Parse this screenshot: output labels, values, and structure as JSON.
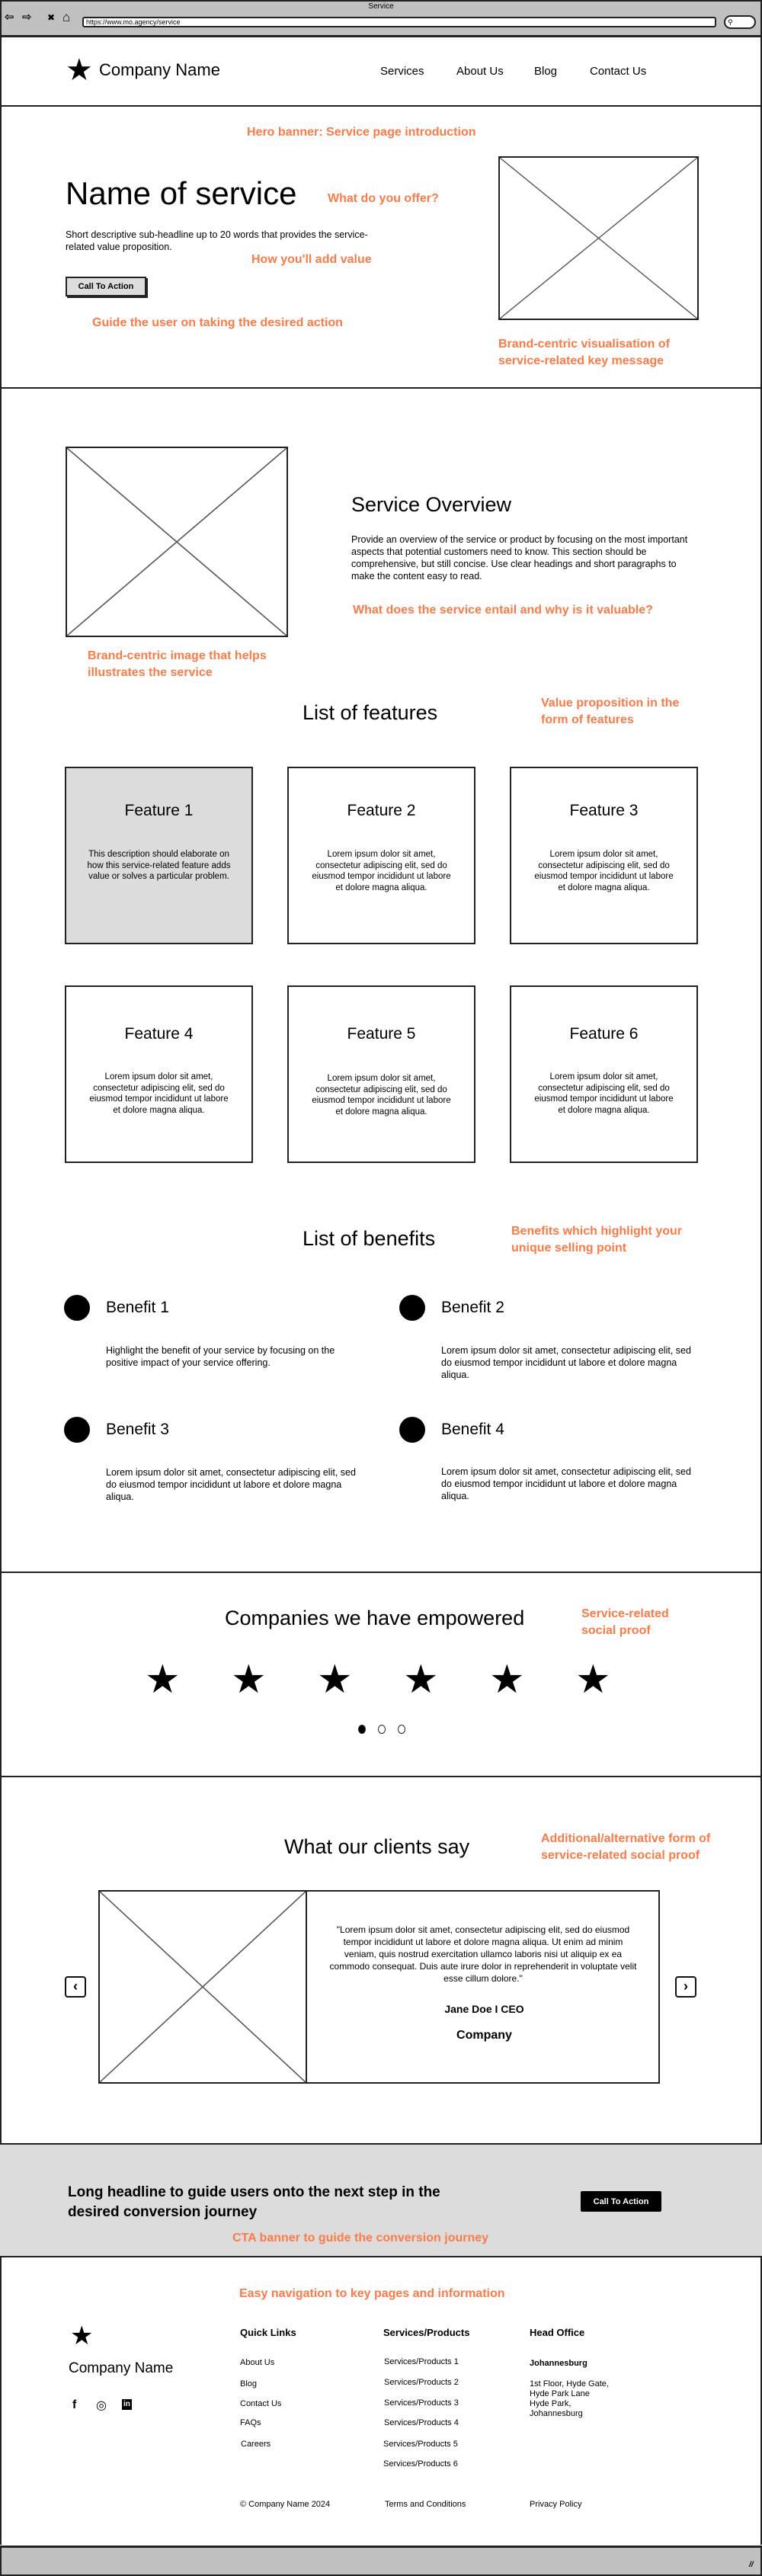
{
  "browser": {
    "title": "Service",
    "url": "https://www.mo.agency/service",
    "icons": [
      "back-arrow-icon",
      "forward-arrow-icon",
      "close-icon",
      "home-icon",
      "search-icon"
    ],
    "back_glyph": "⇦",
    "forward_glyph": "⇨",
    "close_glyph": "✖",
    "home_glyph": "⌂",
    "search_glyph": "⚲",
    "resize_glyph": "//"
  },
  "colors": {
    "annotation": "#ff7a45",
    "card_highlight": "#dcdcdc",
    "chrome": "#c0c0c0"
  },
  "header": {
    "logo_glyph": "★",
    "company_name": "Company Name",
    "nav": [
      "Services",
      "About Us",
      "Blog",
      "Contact Us"
    ]
  },
  "hero": {
    "annotation_top": "Hero banner: Service page introduction",
    "title": "Name of service",
    "annotation_title": "What do you offer?",
    "subheadline": "Short descriptive sub-headline up to 20 words that provides the service-related value proposition.",
    "annotation_value": "How you'll add value",
    "cta_label": "Call To Action",
    "annotation_cta": "Guide the user on taking the desired action",
    "annotation_image": "Brand-centric visualisation of service-related key message"
  },
  "overview": {
    "title": "Service Overview",
    "body": "Provide an overview of the service or product by focusing on the most important aspects that potential customers need to know. This section should be comprehensive, but still concise. Use clear headings and short paragraphs to make the content easy to read.",
    "annotation_body": "What does the service entail and why is it valuable?",
    "annotation_image": "Brand-centric image that helps illustrates the service"
  },
  "features": {
    "title": "List of features",
    "annotation": "Value proposition in the form of features",
    "items": [
      {
        "title": "Feature 1",
        "desc": "This description should elaborate on how this service-related feature adds value or solves a particular problem."
      },
      {
        "title": "Feature 2",
        "desc": "Lorem ipsum dolor sit amet, consectetur adipiscing elit, sed do eiusmod tempor incididunt ut labore et dolore magna aliqua."
      },
      {
        "title": "Feature 3",
        "desc": "Lorem ipsum dolor sit amet, consectetur adipiscing elit, sed do eiusmod tempor incididunt ut labore et dolore magna aliqua."
      },
      {
        "title": "Feature 4",
        "desc": "Lorem ipsum dolor sit amet, consectetur adipiscing elit, sed do eiusmod tempor incididunt ut labore et dolore magna aliqua."
      },
      {
        "title": "Feature 5",
        "desc": "Lorem ipsum dolor sit amet, consectetur adipiscing elit, sed do eiusmod tempor incididunt ut labore et dolore magna aliqua."
      },
      {
        "title": "Feature 6",
        "desc": "Lorem ipsum dolor sit amet, consectetur adipiscing elit, sed do eiusmod tempor incididunt ut labore et dolore magna aliqua."
      }
    ]
  },
  "benefits": {
    "title": "List of benefits",
    "annotation": "Benefits which highlight your unique selling point",
    "items": [
      {
        "title": "Benefit 1",
        "desc": "Highlight the benefit of your service by focusing on the positive impact of your service offering."
      },
      {
        "title": "Benefit 2",
        "desc": "Lorem ipsum dolor sit amet, consectetur adipiscing elit, sed do eiusmod tempor incididunt ut labore et dolore magna aliqua."
      },
      {
        "title": "Benefit 3",
        "desc": "Lorem ipsum dolor sit amet, consectetur adipiscing elit, sed do eiusmod tempor incididunt ut labore et dolore magna aliqua."
      },
      {
        "title": "Benefit 4",
        "desc": "Lorem ipsum dolor sit amet, consectetur adipiscing elit, sed do eiusmod tempor incididunt ut labore et dolore magna aliqua."
      }
    ]
  },
  "companies": {
    "title": "Companies we have empowered",
    "annotation": "Service-related social proof",
    "logo_glyph": "★",
    "logo_count": 6,
    "pagination": {
      "total": 3,
      "active": 1
    }
  },
  "testimonials": {
    "title": "What our clients say",
    "annotation": "Additional/alternative form of service-related social proof",
    "quote": "\"Lorem ipsum dolor sit amet, consectetur adipiscing elit, sed do eiusmod tempor incididunt ut labore et dolore magna aliqua. Ut enim ad minim veniam, quis nostrud exercitation ullamco laboris nisi ut aliquip ex ea commodo consequat. Duis aute irure dolor in reprehenderit in voluptate velit esse cillum dolore.\"",
    "author": "Jane Doe I CEO",
    "company": "Company",
    "prev_glyph": "‹",
    "next_glyph": "›"
  },
  "cta_banner": {
    "headline": "Long headline to guide users onto the next step in the desired conversion journey",
    "button_label": "Call To Action",
    "annotation": "CTA banner to guide the conversion journey"
  },
  "footer": {
    "annotation": "Easy navigation to key pages and information",
    "logo_glyph": "★",
    "company_name": "Company Name",
    "social": [
      {
        "name": "facebook",
        "glyph": "f"
      },
      {
        "name": "instagram",
        "glyph": "◎"
      },
      {
        "name": "linkedin",
        "glyph": "in"
      }
    ],
    "quick_links": {
      "title": "Quick Links",
      "items": [
        "About Us",
        "Blog",
        "Contact Us",
        "FAQs",
        "Careers"
      ]
    },
    "services": {
      "title": "Services/Products",
      "items": [
        "Services/Products 1",
        "Services/Products 2",
        "Services/Products 3",
        "Services/Products 4",
        "Services/Products 5",
        "Services/Products 6"
      ]
    },
    "head_office": {
      "title": "Head Office",
      "city": "Johannesburg",
      "address_lines": [
        "1st Floor, Hyde Gate,",
        "Hyde Park Lane",
        "Hyde Park,",
        "Johannesburg"
      ]
    },
    "copyright": "© Company Name 2024",
    "terms": "Terms and Conditions",
    "privacy": "Privacy Policy"
  }
}
